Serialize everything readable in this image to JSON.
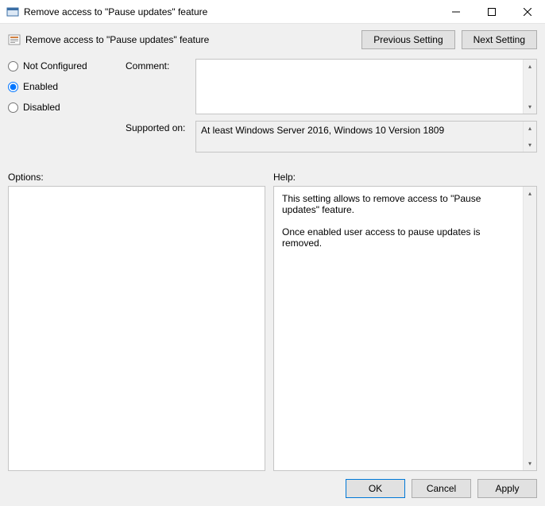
{
  "window": {
    "title": "Remove access to \"Pause updates\" feature"
  },
  "header": {
    "title": "Remove access to \"Pause updates\" feature",
    "prev_btn": "Previous Setting",
    "next_btn": "Next Setting"
  },
  "state": {
    "options": {
      "not_configured": "Not Configured",
      "enabled": "Enabled",
      "disabled": "Disabled"
    },
    "selected": "enabled"
  },
  "fields": {
    "comment_label": "Comment:",
    "comment_value": "",
    "supported_label": "Supported on:",
    "supported_value": "At least Windows Server 2016, Windows 10 Version 1809"
  },
  "panels": {
    "options_label": "Options:",
    "help_label": "Help:",
    "help_text_1": "This setting allows to remove access to \"Pause updates\" feature.",
    "help_text_2": "Once enabled user access to pause updates is removed."
  },
  "footer": {
    "ok": "OK",
    "cancel": "Cancel",
    "apply": "Apply"
  }
}
